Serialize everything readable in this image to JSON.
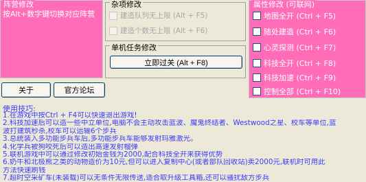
{
  "faction": {
    "title": "阵营修改",
    "hint": "按Alt+数字键切换对应阵营"
  },
  "misc": {
    "title": "杂项修改",
    "options": [
      {
        "label": "建造队列无上限 (Alt + F5)",
        "checked": false,
        "enabled": false
      },
      {
        "label": "建造个数无上限 (Alt + F6)",
        "checked": false,
        "enabled": false
      }
    ]
  },
  "single": {
    "title": "单机任务修改",
    "pass_button": "立即过关 (Alt + F8)"
  },
  "buttons": {
    "about": "关于",
    "forum": "官方论坛"
  },
  "props": {
    "title": "属性修改 (可联网)",
    "options": [
      {
        "label": "地图全开 (Ctrl + F5)",
        "checked": false
      },
      {
        "label": "随处建造 (Ctrl + F6)",
        "checked": false
      },
      {
        "label": "心灵探测 (Ctrl + F7)",
        "checked": false
      },
      {
        "label": "科技全开 (Ctrl + F8)",
        "checked": false
      },
      {
        "label": "科技加速 (Ctrl + F9)",
        "checked": false
      },
      {
        "label": "控制全部 (Ctrl + F10)",
        "checked": false
      }
    ]
  },
  "tips": {
    "title": "使用技巧:",
    "lines": [
      "1.在游戏中按Ctrl + F4可以快速退出游戏!",
      "2.科技加速后可以造一些中立单位,电脑不会主动攻击蓝波、魔鬼终结者、Westwood之星、校车等单位,蓝",
      "波打建筑秒杀,校车可以运输6个步兵",
      "3.总统装入多功能步兵车后,多功能步兵车能够发射玛雅激光。",
      "4.化学兵被狗咬死后可以造出高速发射榴弹",
      "5.联机游戏中可以通过修改初始金钱为2000,配合科技全开来获得优势",
      "6.奶牛和北极熊之类的动物造价为10元,但可以进入复制中心(或者部队回收站)卖2000元,联机时可用此",
      "方法快速刷钱",
      "7.超时空采矿车(未装载)可以无条件无限传送,适合取升级工具箱,还可以骚扰敌方步兵"
    ]
  }
}
